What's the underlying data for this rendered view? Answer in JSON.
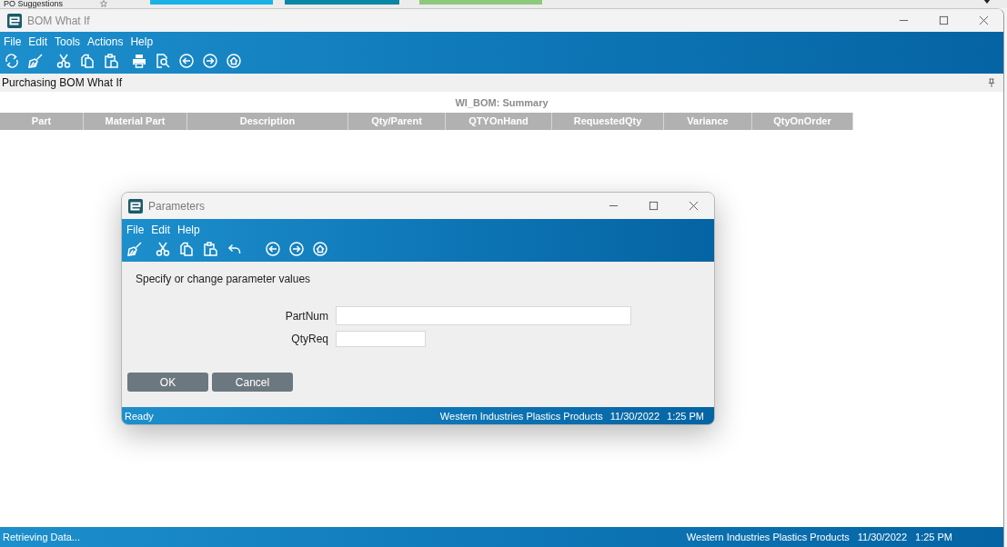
{
  "background_window": {
    "title": "PO Suggestions"
  },
  "window": {
    "title": "BOM What If",
    "menu": [
      "File",
      "Edit",
      "Tools",
      "Actions",
      "Help"
    ]
  },
  "panel": {
    "title": "Purchasing BOM What If"
  },
  "grid": {
    "title": "WI_BOM: Summary",
    "columns": [
      "Part",
      "Material Part",
      "Description",
      "Qty/Parent",
      "QTYOnHand",
      "RequestedQty",
      "Variance",
      "QtyOnOrder"
    ]
  },
  "dialog": {
    "title": "Parameters",
    "menu": [
      "File",
      "Edit",
      "Help"
    ],
    "instruction": "Specify or change parameter values",
    "fields": [
      {
        "label": "PartNum"
      },
      {
        "label": "QtyReq"
      }
    ],
    "buttons": [
      "OK",
      "Cancel"
    ],
    "status_bar": {
      "status": "Ready",
      "company": "Western Industries Plastics Products",
      "date": "11/30/2022",
      "time": "1:25 PM"
    }
  },
  "status_bar": {
    "status": "Retrieving Data...",
    "company": "Western Industries Plastics Products",
    "date": "11/30/2022",
    "time": "1:25 PM"
  }
}
